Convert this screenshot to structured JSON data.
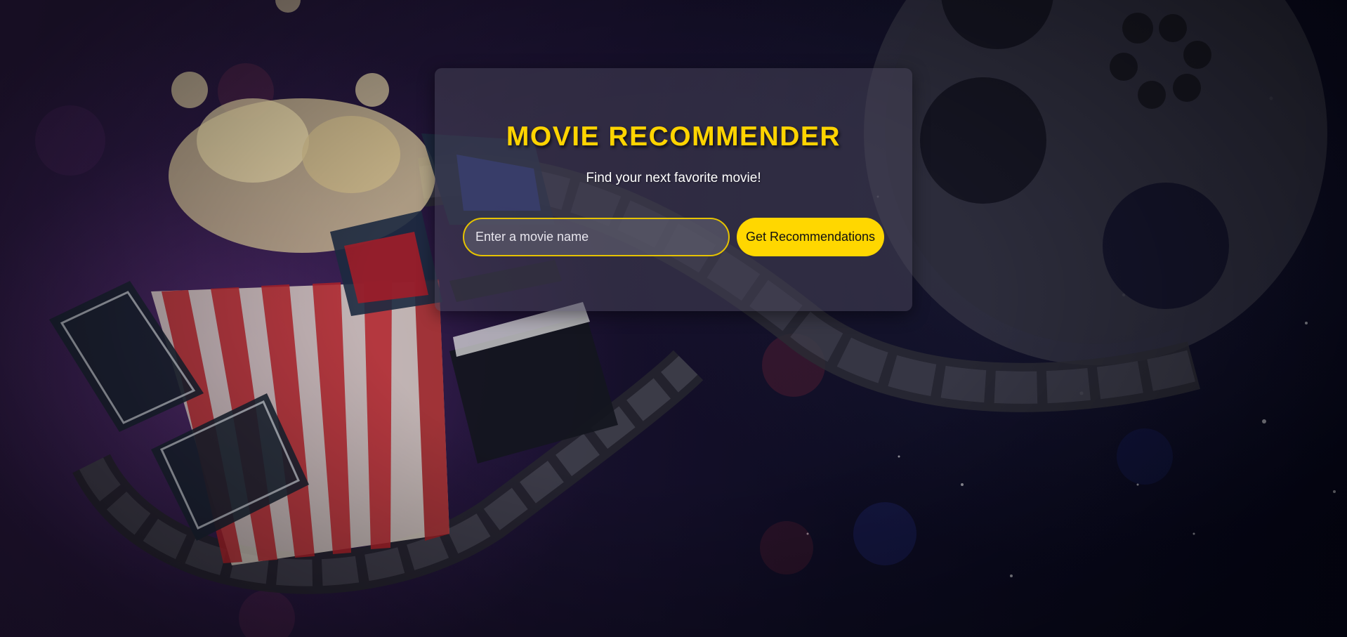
{
  "page": {
    "title": "MOVIE RECOMMENDER",
    "subtitle": "Find your next favorite movie!"
  },
  "search": {
    "placeholder": "Enter a movie name",
    "value": "",
    "button_label": "Get Recommendations"
  },
  "colors": {
    "accent": "#ffd700",
    "title": "#ffd400",
    "card_background": "rgba(70,66,86,0.55)",
    "page_background": "#0b0a1c"
  },
  "background": {
    "icons": [
      "popcorn-icon",
      "3d-glasses-icon",
      "cinema-ticket-icon",
      "clapperboard-icon",
      "film-reel-icon",
      "film-strip-icon"
    ]
  }
}
